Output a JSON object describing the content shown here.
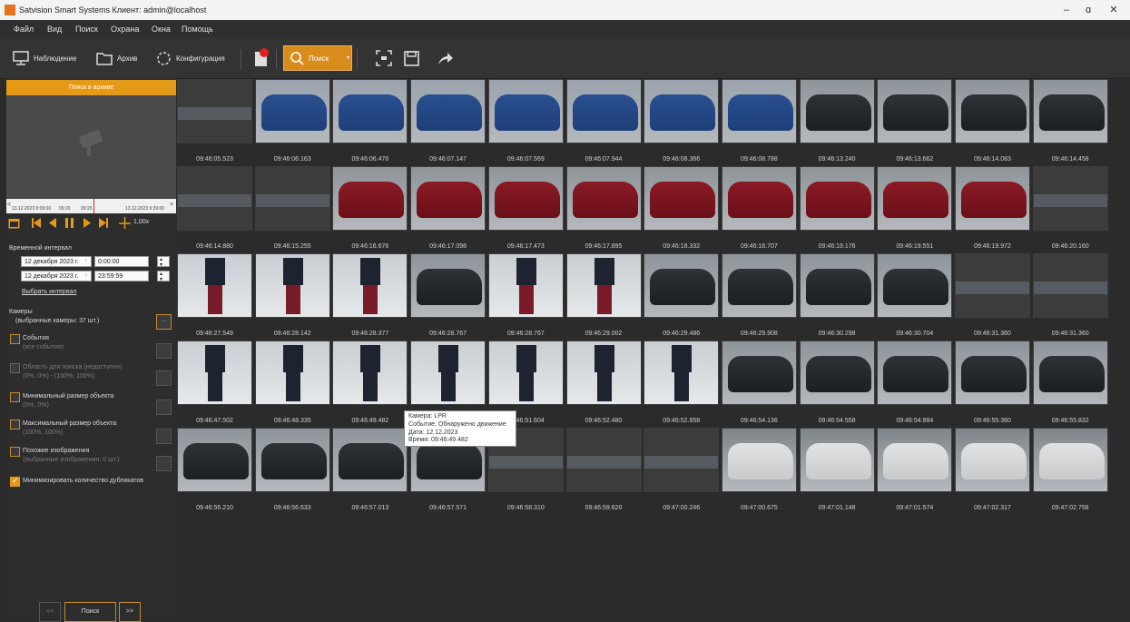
{
  "window": {
    "title": "Satvision Smart Systems Клиент: admin@localhost",
    "minimize": "–",
    "restore": "ɑ",
    "close": "✕"
  },
  "menu": [
    "Файл",
    "Вид",
    "Поиск",
    "Охрана",
    "Окна",
    "Помощь"
  ],
  "toolbar": {
    "monitoring": "Наблюдение",
    "archive": "Архив",
    "config": "Конфигурация",
    "search": "Поиск"
  },
  "left": {
    "header": "Поиск в архиве",
    "timeline": {
      "start": "13.12.2023 9:09:00",
      "t1": "09:20",
      "t2": "09:25",
      "end": "13.12.2023 9:39:00"
    },
    "speed": "1,00x",
    "interval_label": "Временной интервал",
    "date_from": "12 декабря  2023 г.",
    "time_from": "0:00:00",
    "date_to": "12 декабря  2023 г.",
    "time_to": "23:59:59",
    "choose_interval": "Выбрать интервал",
    "cameras_label": "Камеры",
    "cameras_selected": "(выбранные камеры: 37 шт.)",
    "cameras_btn": "...",
    "events_label": "События",
    "events_sub": "(все события)",
    "area_label": "Область для поиска (недоступно)",
    "area_sub": "(0%, 0%) - (100%, 100%)",
    "min_label": "Минимальный размер объекта",
    "min_sub": "(0%, 0%)",
    "max_label": "Максимальный размер объекта",
    "max_sub": "(100%, 100%)",
    "similar_label": "Похожие изображения",
    "similar_sub": "(выбранные изображения: 0 шт.)",
    "dedupe_label": "Минимизировать количество дубликатов",
    "prev_btn": "<<",
    "search_btn": "Поиск",
    "next_btn": ">>"
  },
  "rows": [
    [
      "09:46:05.523",
      "09:46:06.163",
      "09:46:06.476",
      "09:46:07.147",
      "09:46:07.569",
      "09:46:07.944",
      "09:46:08.366",
      "09:46:08.788",
      "09:46:13.240",
      "09:46:13.662",
      "09:46:14.083",
      "09:46:14.458"
    ],
    [
      "09:46:14.880",
      "09:46:15.255",
      "09:46:16.676",
      "09:46:17.098",
      "09:46:17.473",
      "09:46:17.895",
      "09:46:18.332",
      "09:46:18.707",
      "09:46:19.176",
      "09:46:19.551",
      "09:46:19.972",
      "09:46:20.160"
    ],
    [
      "09:46:27.549",
      "09:46:28.142",
      "09:46:28.377",
      "09:46:28.767",
      "09:46:28.767",
      "09:46:29.002",
      "09:46:29.486",
      "09:46:29.908",
      "09:46:30.298",
      "09:46:30.704",
      "09:46:31.360",
      "09:46:31.360"
    ],
    [
      "09:46:47.502",
      "09:46:48.335",
      "09:46:49.482",
      "",
      "09:46:51.604",
      "09:46:52.480",
      "09:46:52.858",
      "09:46:54.136",
      "09:46:54.558",
      "09:46:54.984",
      "09:46:55.360",
      "09:46:55.832"
    ],
    [
      "09:46:56.210",
      "09:46:56.633",
      "09:46:57.013",
      "09:46:57.571",
      "09:46:58.310",
      "09:46:59.620",
      "09:47:00.246",
      "09:47:00.675",
      "09:47:01.148",
      "09:47:01.574",
      "09:47:02.317",
      "09:47:02.758"
    ]
  ],
  "thumb_kinds": [
    [
      "dark",
      "blue",
      "blue",
      "blue",
      "blue",
      "blue",
      "blue",
      "blue",
      "black",
      "black",
      "black",
      "black"
    ],
    [
      "dark",
      "dark",
      "red",
      "red",
      "red",
      "red",
      "red",
      "red",
      "red",
      "red",
      "red",
      "dark"
    ],
    [
      "person",
      "person",
      "person",
      "black",
      "person",
      "person",
      "black",
      "black",
      "black",
      "black",
      "dark",
      "dark"
    ],
    [
      "person",
      "person",
      "person",
      "person",
      "person",
      "person",
      "person",
      "black",
      "black",
      "black",
      "black",
      "black"
    ],
    [
      "black",
      "black",
      "black",
      "black",
      "dark",
      "dark",
      "dark",
      "white",
      "white",
      "white",
      "white",
      "white"
    ]
  ],
  "tooltip": {
    "camera": "Камера: LPR",
    "event": "Событие: Обнаружено движение",
    "date": "Дата: 12.12.2023",
    "time": "Время: 09:46:49.482"
  },
  "colors": {
    "accent": "#e59a17",
    "background": "#2b2b2b"
  }
}
